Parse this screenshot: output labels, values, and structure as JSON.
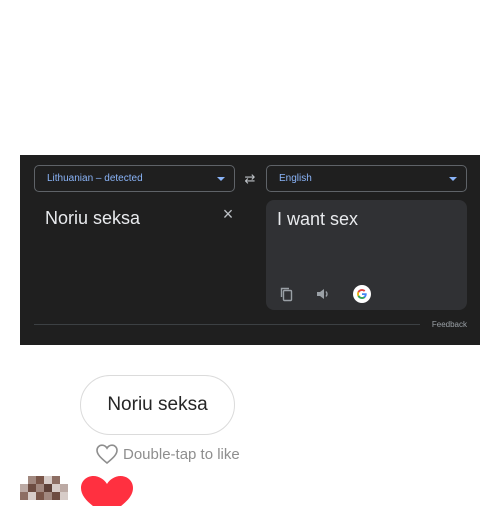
{
  "translate": {
    "source_language": "Lithuanian – detected",
    "target_language": "English",
    "source_text": "Noriu seksa",
    "translated_text": "I want sex",
    "feedback_label": "Feedback"
  },
  "chat": {
    "message_text": "Noriu seksa",
    "like_hint": "Double-tap to like"
  },
  "colors": {
    "card_background": "#1f1f1f",
    "output_panel": "#303134",
    "accent_blue": "#8ab4f8",
    "reaction_heart": "#ff3040"
  },
  "icons": [
    "swap-icon",
    "close-icon",
    "copy-icon",
    "speaker-icon",
    "google-icon",
    "heart-outline-icon",
    "heart-filled-icon"
  ]
}
